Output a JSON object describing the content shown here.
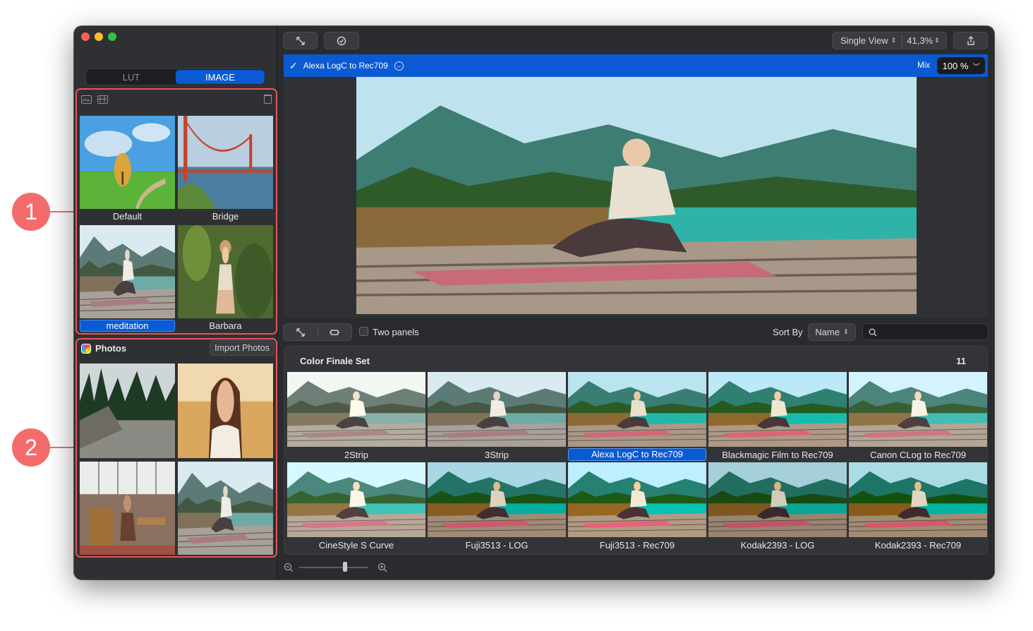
{
  "sidebar": {
    "segmented": {
      "lut_label": "LUT",
      "image_label": "IMAGE",
      "selected": "IMAGE"
    },
    "images": [
      {
        "label": "Default",
        "selected": false
      },
      {
        "label": "Bridge",
        "selected": false
      },
      {
        "label": "meditation",
        "selected": true
      },
      {
        "label": "Barbara",
        "selected": false
      }
    ],
    "photos": {
      "title": "Photos",
      "import_label": "Import Photos"
    }
  },
  "callouts": [
    "1",
    "2"
  ],
  "toolbar": {
    "view_mode": "Single View",
    "zoom": "41,3%"
  },
  "lut_bar": {
    "lut_name": "Alexa LogC to Rec709",
    "mix_label": "Mix",
    "mix_value": "100 %"
  },
  "controls": {
    "two_panels_label": "Two panels",
    "two_panels_checked": false,
    "sort_by_label": "Sort By",
    "sort_value": "Name",
    "search_placeholder": ""
  },
  "lut_set": {
    "title": "Color Finale Set",
    "count": "11",
    "items": [
      {
        "label": "2Strip",
        "selected": false
      },
      {
        "label": "3Strip",
        "selected": false
      },
      {
        "label": "Alexa LogC to Rec709",
        "selected": true
      },
      {
        "label": "Blackmagic Film to Rec709",
        "selected": false
      },
      {
        "label": "Canon CLog to Rec709",
        "selected": false
      },
      {
        "label": "CineStyle S Curve",
        "selected": false
      },
      {
        "label": "Fuji3513 - LOG",
        "selected": false
      },
      {
        "label": "Fuji3513 - Rec709",
        "selected": false
      },
      {
        "label": "Kodak2393 - LOG",
        "selected": false
      },
      {
        "label": "Kodak2393 - Rec709",
        "selected": false
      }
    ]
  },
  "colors": {
    "accent": "#0a5ad4",
    "callout": "#f36c6b",
    "window_bg": "#2a2b2e"
  }
}
